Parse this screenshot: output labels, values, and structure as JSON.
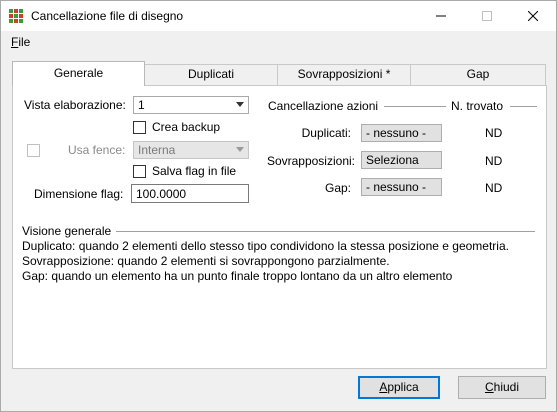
{
  "window": {
    "title": "Cancellazione file di disegno",
    "icon": "app-grid-icon"
  },
  "menu": {
    "file_label": "File",
    "file_mnemonic": "F",
    "file_rest": "ile"
  },
  "tabs": [
    {
      "label": "Generale",
      "active": true
    },
    {
      "label": "Duplicati",
      "active": false
    },
    {
      "label": "Sovrapposizioni *",
      "active": false
    },
    {
      "label": "Gap",
      "active": false
    }
  ],
  "general": {
    "vista_label": "Vista elaborazione:",
    "vista_value": "1",
    "crea_backup_label": "Crea backup",
    "crea_backup_checked": false,
    "usa_fence_label": "Usa fence:",
    "usa_fence_checked": false,
    "usa_fence_value": "Interna",
    "salva_flag_label": "Salva flag in file",
    "salva_flag_checked": false,
    "dimensione_label": "Dimensione flag:",
    "dimensione_value": "100.0000"
  },
  "actions": {
    "header": "Cancellazione azioni",
    "found_header": "N. trovato",
    "rows": [
      {
        "label": "Duplicati:",
        "action": "- nessuno -",
        "found": "ND"
      },
      {
        "label": "Sovrapposizioni:",
        "action": "Seleziona",
        "found": "ND"
      },
      {
        "label": "Gap:",
        "action": "- nessuno -",
        "found": "ND"
      }
    ]
  },
  "overview": {
    "header": "Visione generale",
    "lines": [
      "Duplicato: quando 2 elementi dello stesso tipo condividono la stessa posizione e geometria.",
      "Sovrapposizione: quando 2 elementi si sovrappongono parzialmente.",
      "Gap: quando un elemento ha un punto finale troppo lontano da un altro elemento"
    ]
  },
  "buttons": {
    "apply_mnemonic": "A",
    "apply_rest": "pplica",
    "close_mnemonic": "C",
    "close_rest": "hiudi"
  }
}
